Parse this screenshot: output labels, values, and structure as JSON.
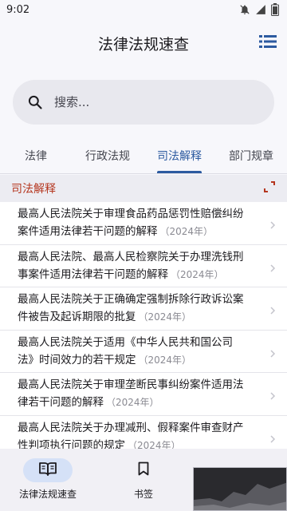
{
  "status_bar": {
    "time": "9:02",
    "icons": [
      "notifications-off-icon",
      "signal-icon",
      "battery-icon"
    ]
  },
  "app_bar": {
    "title": "法律法规速查",
    "action_icon": "list-icon"
  },
  "search": {
    "placeholder": "搜索...",
    "value": ""
  },
  "tabs": [
    {
      "label": "法律",
      "active": false
    },
    {
      "label": "行政法规",
      "active": false
    },
    {
      "label": "司法解释",
      "active": true
    },
    {
      "label": "部门规章",
      "active": false
    }
  ],
  "section": {
    "title": "司法解释",
    "expand_icon": "expand-corners-icon"
  },
  "items": [
    {
      "title": "最高人民法院关于审理食品药品惩罚性赔偿纠纷案件适用法律若干问题的解释",
      "year": "（2024年）"
    },
    {
      "title": "最高人民法院、最高人民检察院关于办理洗钱刑事案件适用法律若干问题的解释",
      "year": "（2024年）"
    },
    {
      "title": "最高人民法院关于正确确定强制拆除行政诉讼案件被告及起诉期限的批复",
      "year": "（2024年）"
    },
    {
      "title": "最高人民法院关于适用《中华人民共和国公司法》时间效力的若干规定",
      "year": "（2024年）"
    },
    {
      "title": "最高人民法院关于审理垄断民事纠纷案件适用法律若干问题的解释",
      "year": "（2024年）"
    },
    {
      "title": "最高人民法院关于办理减刑、假释案件审查财产性判项执行问题的规定",
      "year": "（2024年）"
    }
  ],
  "bottom_nav": [
    {
      "label": "法律法规速查",
      "icon": "book-open-icon",
      "active": true
    },
    {
      "label": "书签",
      "icon": "bookmark-icon",
      "active": false
    }
  ],
  "colors": {
    "accent": "#2c5aa0",
    "section_title": "#b5361f",
    "background": "#f7f7fb",
    "search_bg": "#e8e8ee",
    "nav_pill": "#d5e1f7"
  }
}
